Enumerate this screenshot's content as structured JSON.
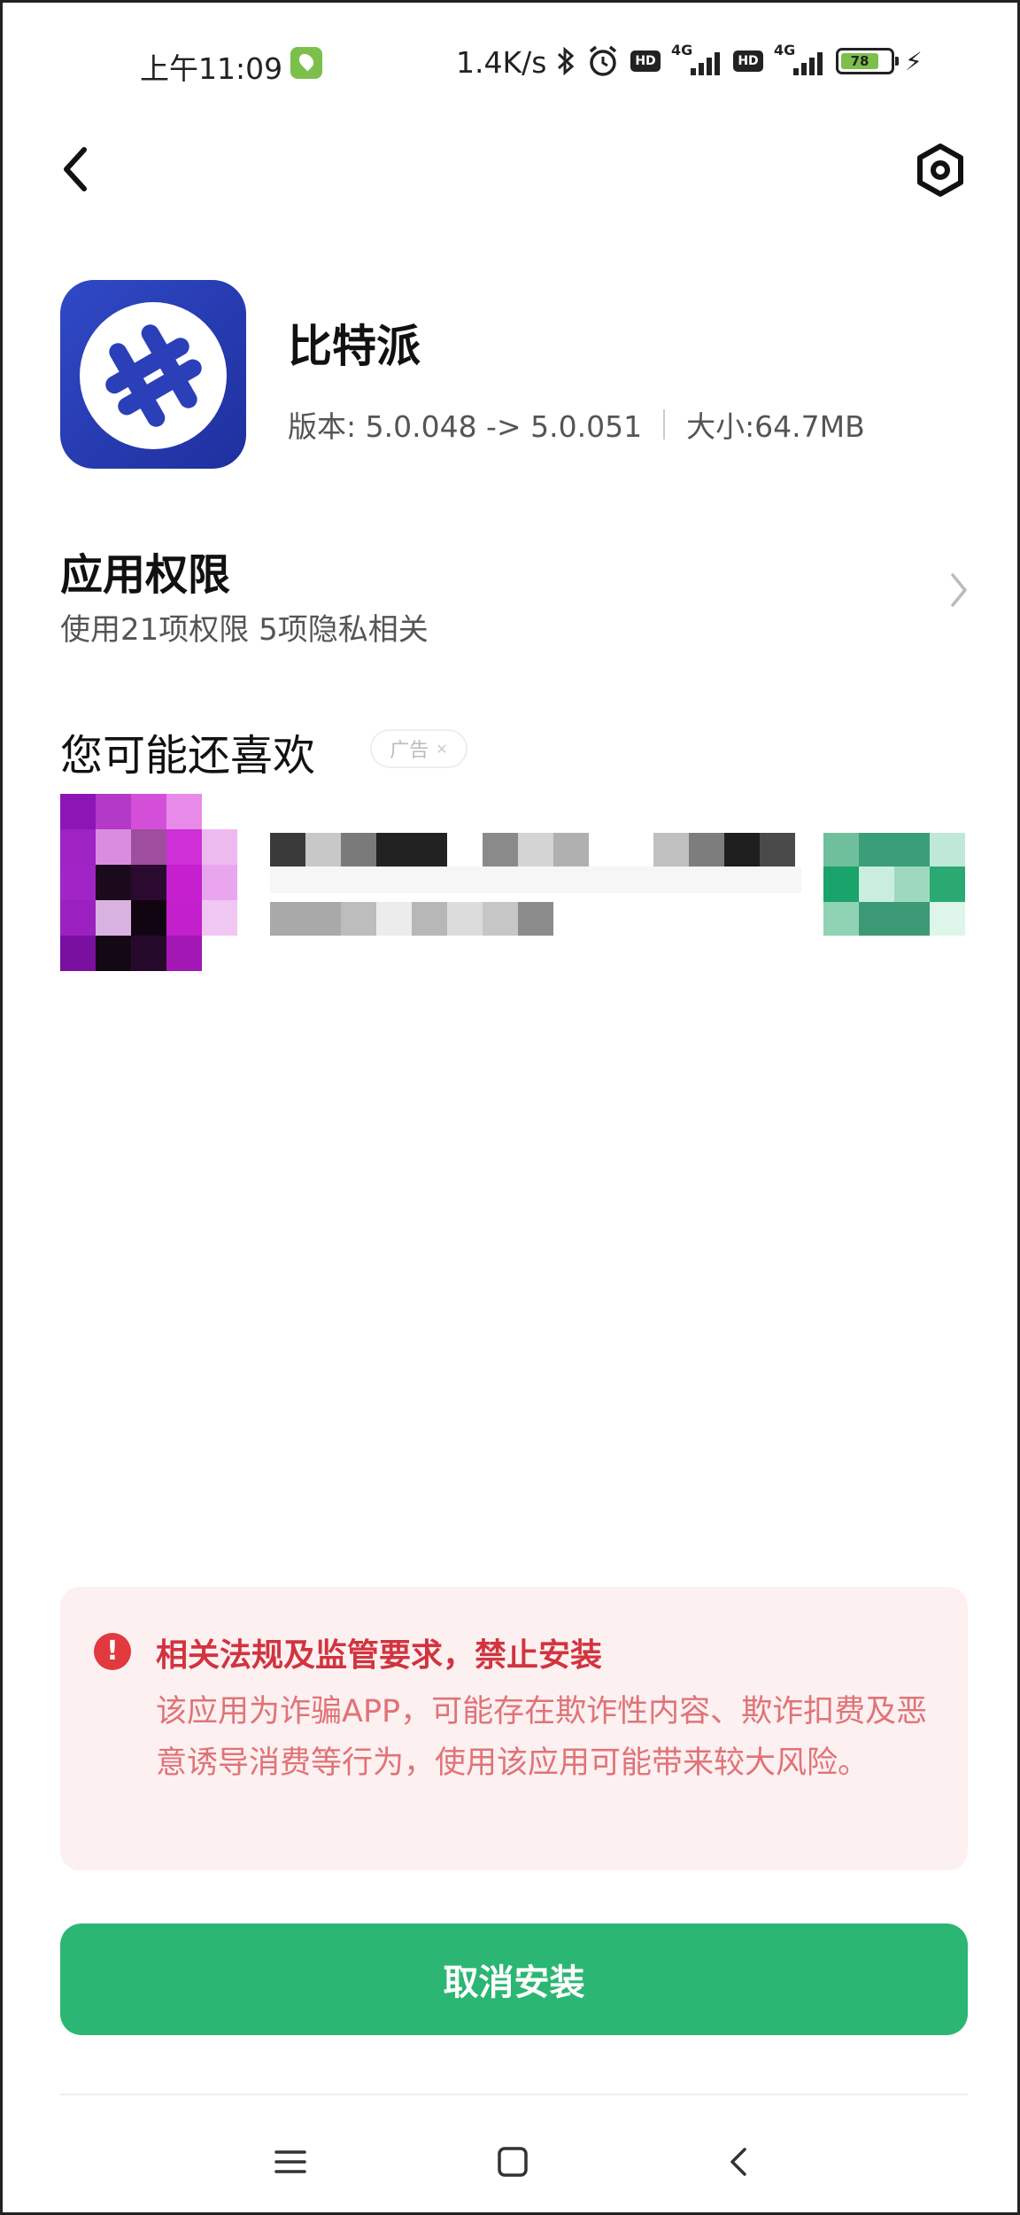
{
  "status_bar": {
    "time": "上午11:09",
    "net_speed": "1.4K/s",
    "hd_label": "HD",
    "network_type": "4G",
    "battery_level": "78",
    "icons": [
      "wechat-leaf-icon",
      "bluetooth-icon",
      "alarm-icon",
      "hd-icon",
      "signal-icon",
      "battery-icon",
      "charging-icon"
    ]
  },
  "top_bar": {
    "back_icon": "chevron-left-icon",
    "settings_icon": "hexagon-settings-icon"
  },
  "app": {
    "name": "比特派",
    "version": "版本: 5.0.048 -> 5.0.051",
    "size": "大小:64.7MB",
    "icon_color": "#2e45c0"
  },
  "permissions": {
    "title": "应用权限",
    "subtitle": "使用21项权限 5项隐私相关"
  },
  "recommendations": {
    "title": "您可能还喜欢",
    "ad_label": "广告"
  },
  "warning": {
    "title": "相关法规及监管要求，禁止安装",
    "body": "该应用为诈骗APP，可能存在欺诈性内容、欺诈扣费及恶意诱导消费等行为，使用该应用可能带来较大风险。",
    "accent": "#e0393e"
  },
  "actions": {
    "cancel_label": "取消安装",
    "accent": "#2bb673"
  },
  "nav_bar": {
    "icons": [
      "menu-icon",
      "home-icon",
      "back-icon"
    ]
  }
}
